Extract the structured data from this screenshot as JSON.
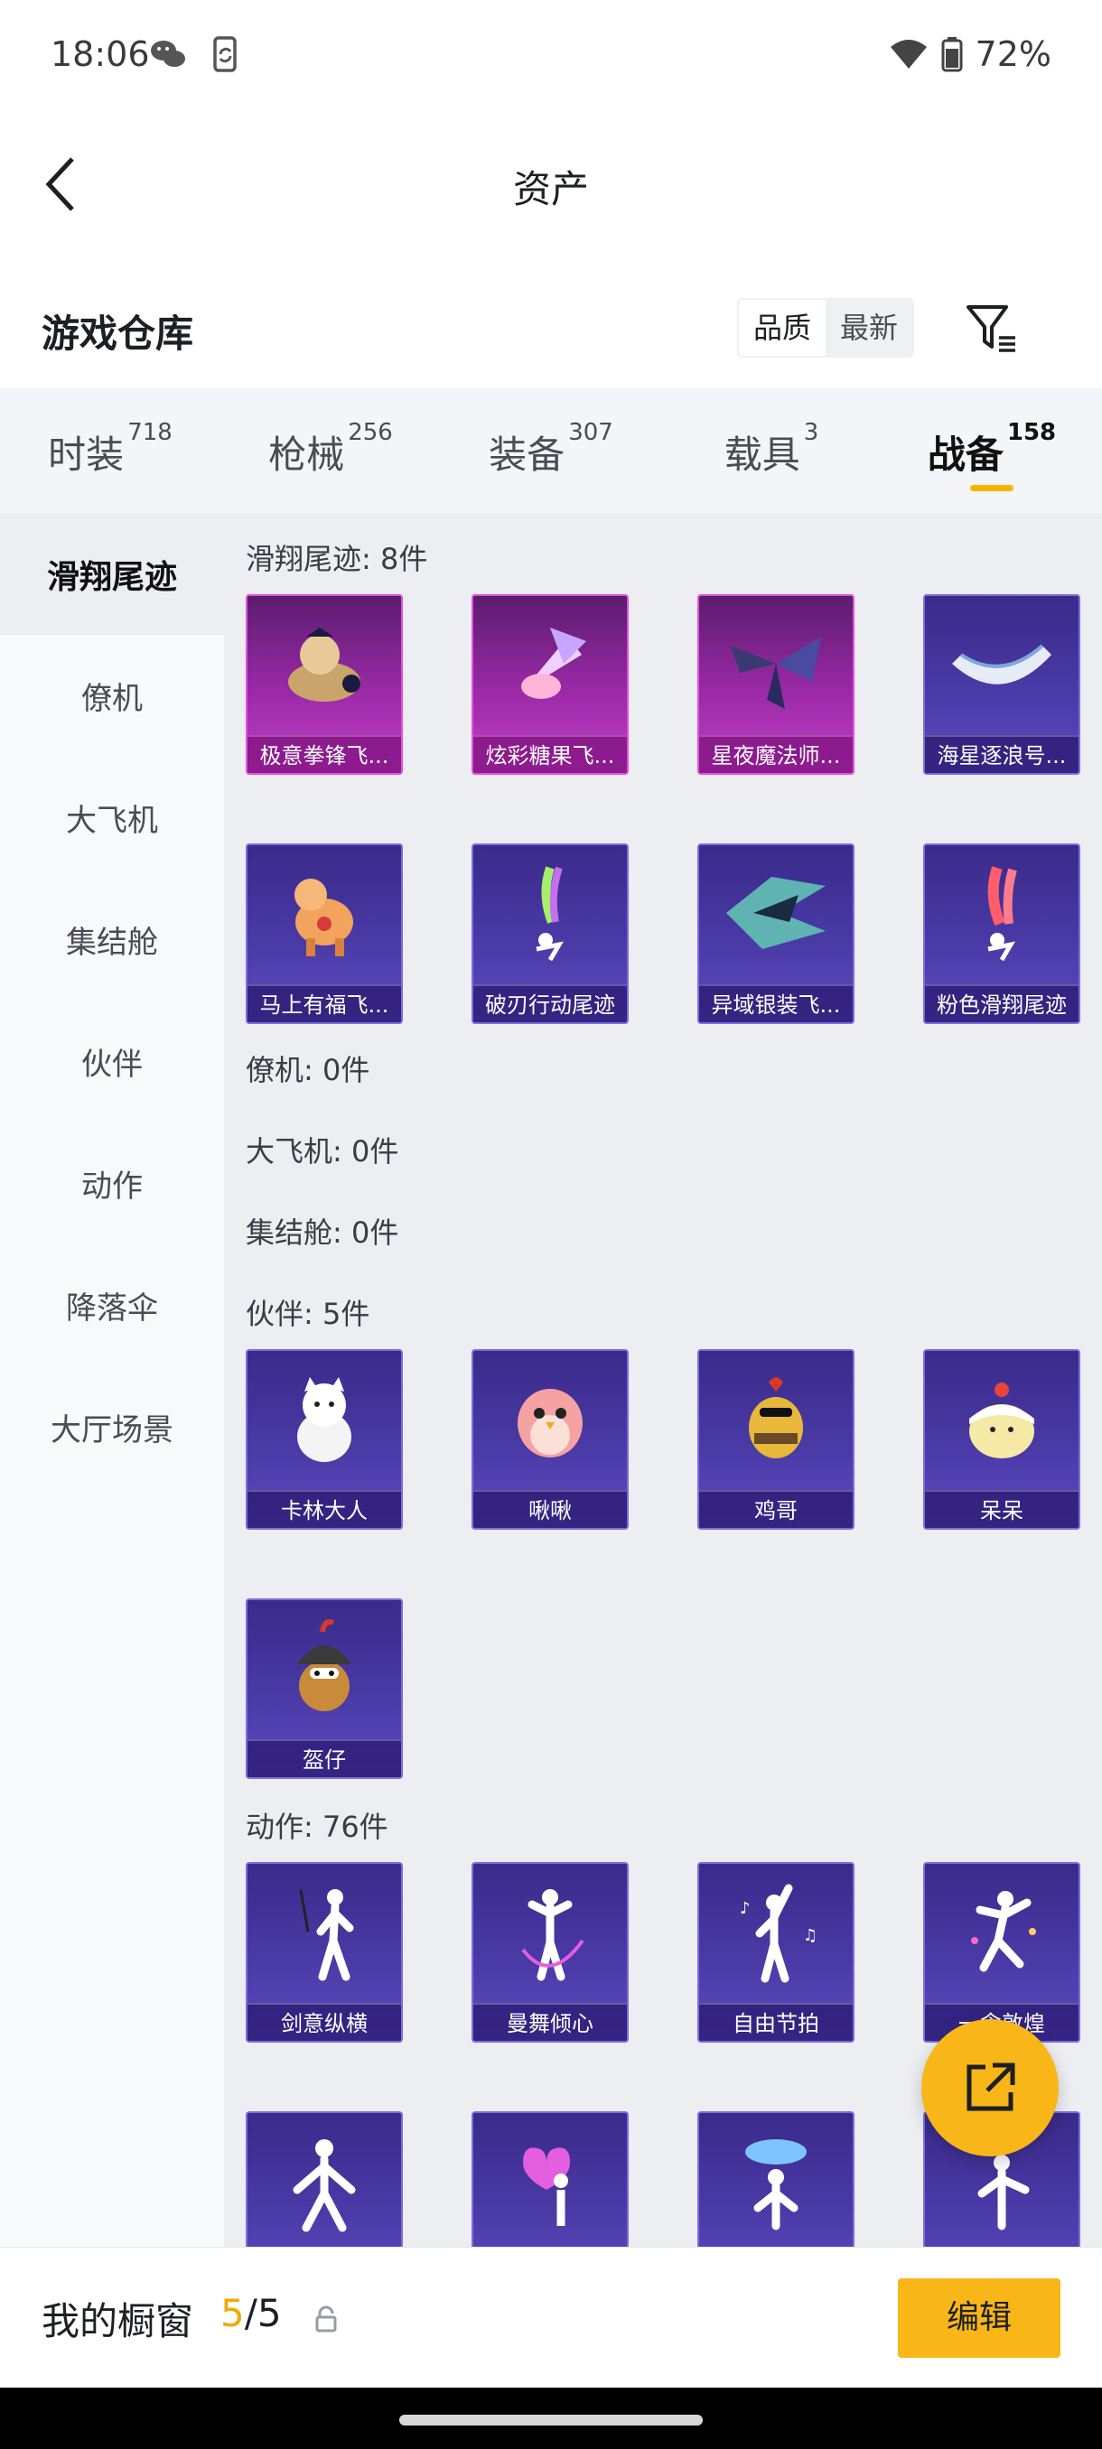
{
  "status": {
    "time": "18:06",
    "battery": "72%"
  },
  "header": {
    "title": "资产"
  },
  "warehouse": {
    "title": "游戏仓库",
    "sort_quality": "品质",
    "sort_newest": "最新"
  },
  "tabs": [
    {
      "label": "时装",
      "count": "718"
    },
    {
      "label": "枪械",
      "count": "256"
    },
    {
      "label": "装备",
      "count": "307"
    },
    {
      "label": "载具",
      "count": "3"
    },
    {
      "label": "战备",
      "count": "158"
    }
  ],
  "sidebar": [
    "滑翔尾迹",
    "僚机",
    "大飞机",
    "集结舱",
    "伙伴",
    "动作",
    "降落伞",
    "大厅场景"
  ],
  "sections": {
    "glide": {
      "label": "滑翔尾迹: 8件",
      "items": [
        "极意拳锋飞...",
        "炫彩糖果飞...",
        "星夜魔法师...",
        "海星逐浪号...",
        "马上有福飞...",
        "破刃行动尾迹",
        "异域银装飞...",
        "粉色滑翔尾迹"
      ]
    },
    "wingman": {
      "label": "僚机: 0件"
    },
    "plane": {
      "label": "大飞机: 0件"
    },
    "pod": {
      "label": "集结舱: 0件"
    },
    "partner": {
      "label": "伙伴: 5件",
      "items": [
        "卡林大人",
        "啾啾",
        "鸡哥",
        "呆呆",
        "盔仔"
      ]
    },
    "action": {
      "label": "动作: 76件",
      "items": [
        "剑意纵横",
        "曼舞倾心",
        "自由节拍",
        "一念敦煌"
      ]
    }
  },
  "bottom": {
    "label": "我的橱窗",
    "count_used": "5",
    "count_sep": "/",
    "count_total": "5",
    "edit": "编辑"
  },
  "colors": {
    "accent": "#f8b619",
    "purple_card": "#4a3aa6",
    "pink_card": "#9c2aa8"
  }
}
